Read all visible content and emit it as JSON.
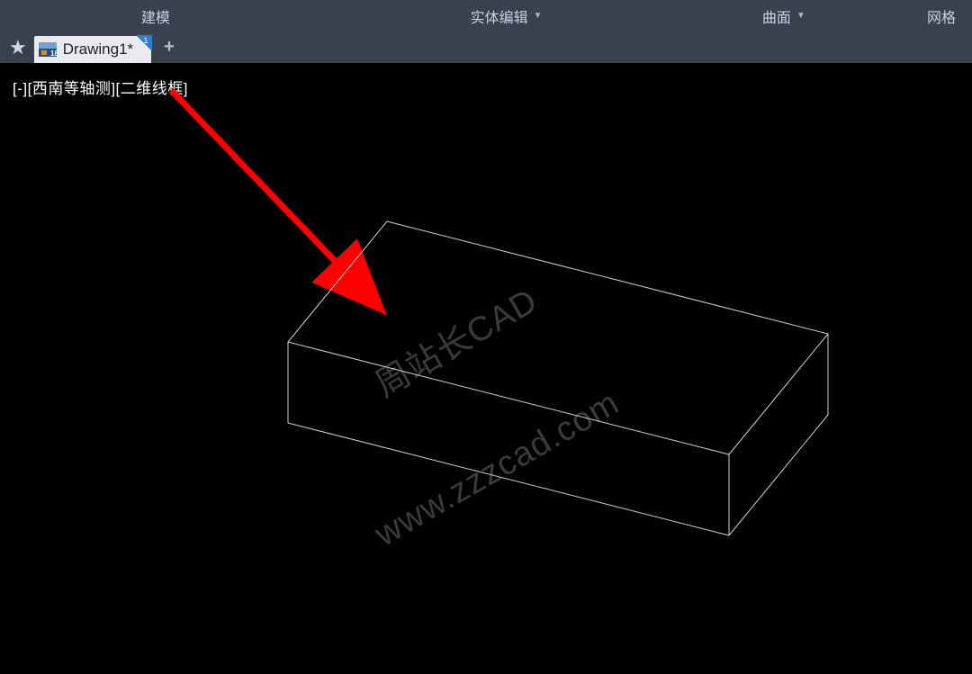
{
  "topbar": {
    "modeling": "建模",
    "solid_edit": "实体编辑",
    "surface": "曲面",
    "mesh": "网格"
  },
  "tabbar": {
    "file_label": "Drawing1*",
    "file_badge": "1"
  },
  "viewport": {
    "label": "[-][西南等轴测][二维线框]"
  },
  "watermark": {
    "text1": "周站长CAD",
    "text2": "www.zzzcad.com"
  }
}
